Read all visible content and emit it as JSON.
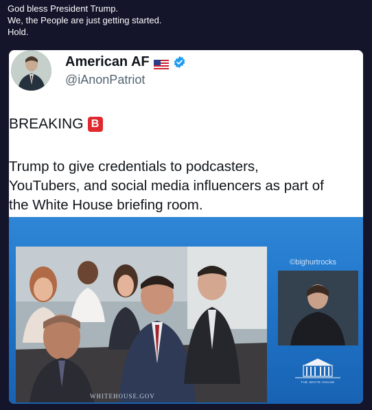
{
  "post": {
    "lines": [
      "God bless President Trump.",
      "We, the People are just getting started.",
      "Hold."
    ]
  },
  "tweet": {
    "display_name": "American AF",
    "flag_icon": "us-flag-icon",
    "verified_icon": "verified-badge-icon",
    "handle": "@iAnonPatriot",
    "breaking_label": "BREAKING",
    "breaking_badge": "B",
    "body_lines": [
      "Trump to give credentials to podcasters,",
      "YouTubers, and social media influencers as part of",
      "the White House briefing room."
    ]
  },
  "image": {
    "watermark_left": "WHITEHOUSE.GOV",
    "watermark_right": "©bighurtrocks",
    "wh_logo_text": "THE WHITE HOUSE"
  },
  "colors": {
    "background": "#14142b",
    "verified": "#1d9bf0",
    "breaking_badge": "#e0282e",
    "image_blue": "#1f74c8"
  }
}
